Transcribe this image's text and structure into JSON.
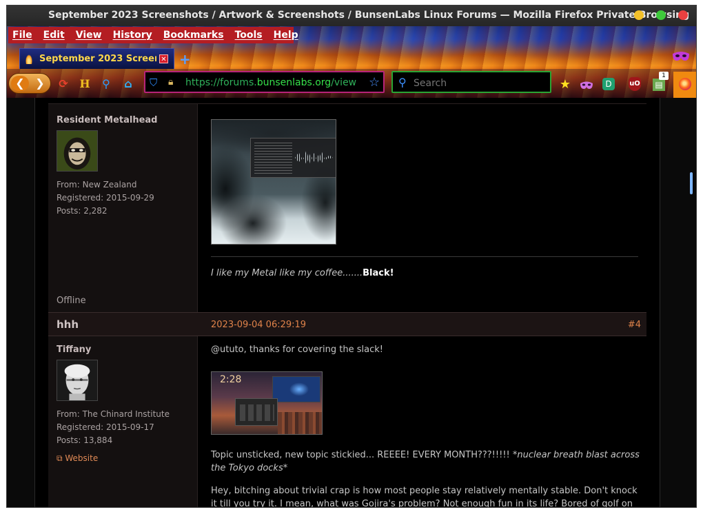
{
  "window": {
    "title": "September 2023 Screenshots / Artwork & Screenshots / BunsenLabs Linux Forums — Mozilla Firefox Private Browsing"
  },
  "menu": [
    "File",
    "Edit",
    "View",
    "History",
    "Bookmarks",
    "Tools",
    "Help"
  ],
  "tab": {
    "title": "September 2023 Screens",
    "close_glyph": "✕",
    "new_tab_glyph": "+"
  },
  "navbar": {
    "back_glyph": "❮",
    "forward_glyph": "❯",
    "url_prefix": "https://forums.",
    "url_domain": "bunsenlabs.org",
    "url_rest": "/view",
    "search_placeholder": "Search",
    "ext_badge": "1",
    "icons": [
      "reload-icon",
      "home-icon",
      "zoom-icon",
      "sync-icon",
      "shield-icon",
      "lock-icon",
      "star-icon",
      "search-icon",
      "bookmark-star-icon",
      "private-mask-icon",
      "extension-icon",
      "ublock-icon",
      "extension-badge-icon",
      "firefox-icon"
    ]
  },
  "colors": {
    "menubar": "#b41d22",
    "url_border": "#b8237a",
    "search_border": "#2aa534",
    "accent_orange": "#e0834a"
  },
  "post1": {
    "user_title": "Resident Metalhead",
    "from": "From: New Zealand",
    "registered": "Registered: 2015-09-29",
    "posts": "Posts: 2,282",
    "status": "Offline",
    "signature_italic": "I like my Metal like my coffee.......",
    "signature_bold": "Black!"
  },
  "post2": {
    "author": "hhh",
    "date": "2023-09-04 06:29:19",
    "number": "#4",
    "user_title": "Tiffany",
    "from": "From: The Chinard Institute",
    "registered": "Registered: 2015-09-17",
    "posts": "Posts: 13,884",
    "website": "Website",
    "paragraph1": "@ututo, thanks for covering the slack!",
    "thumb_clock": "2:28",
    "paragraph2_plain": "Topic unsticked, new topic stickied... REEEE! EVERY MONTH???!!!!! ",
    "paragraph2_italic": "*nuclear breath blast across the Tokyo docks*",
    "paragraph3": "Hey, bitching about trivial crap is how most people stay relatively mentally stable. Don't knock it till you try it. I mean, what was Gojira's problem? Not enough fun in its life? Bored of golf on"
  }
}
